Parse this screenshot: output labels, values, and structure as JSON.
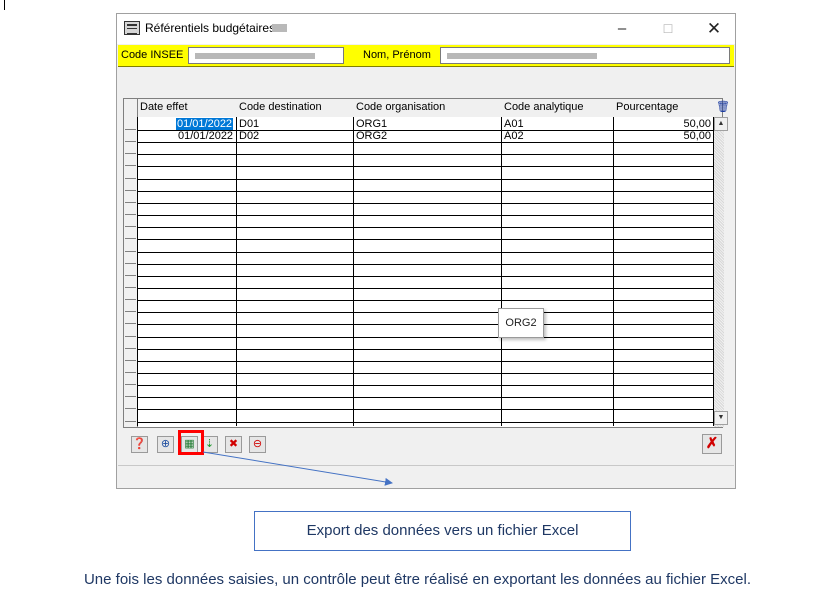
{
  "window": {
    "title": "Référentiels budgétaires",
    "controls": {
      "minimize": "–",
      "maximize": "☐",
      "close": "✕"
    }
  },
  "header_fields": {
    "code_insee_label": "Code INSEE",
    "nom_prenom_label": "Nom, Prénom"
  },
  "grid": {
    "columns": [
      "Date effet",
      "Code destination",
      "Code organisation",
      "Code analytique",
      "Pourcentage"
    ],
    "rows": [
      {
        "date_effet": "01/01/2022",
        "code_destination": "D01",
        "code_organisation": "ORG1",
        "code_analytique": "A01",
        "pourcentage": "50,00"
      },
      {
        "date_effet": "01/01/2022",
        "code_destination": "D02",
        "code_organisation": "ORG2",
        "code_analytique": "A02",
        "pourcentage": "50,00"
      }
    ],
    "tooltip": "ORG2"
  },
  "toolbar": {
    "icons": [
      "help-icon",
      "add-icon",
      "excel-export-icon",
      "import-icon",
      "delete-icon",
      "remove-icon"
    ],
    "cancel_icon": "red-x-icon"
  },
  "annotation": {
    "callout": "Export des données vers un fichier Excel",
    "caption": "Une fois les données saisies, un contrôle peut être réalisé en exportant les données au fichier Excel.",
    "accent_color": "#4472c4",
    "highlight_color": "#ff0000"
  }
}
